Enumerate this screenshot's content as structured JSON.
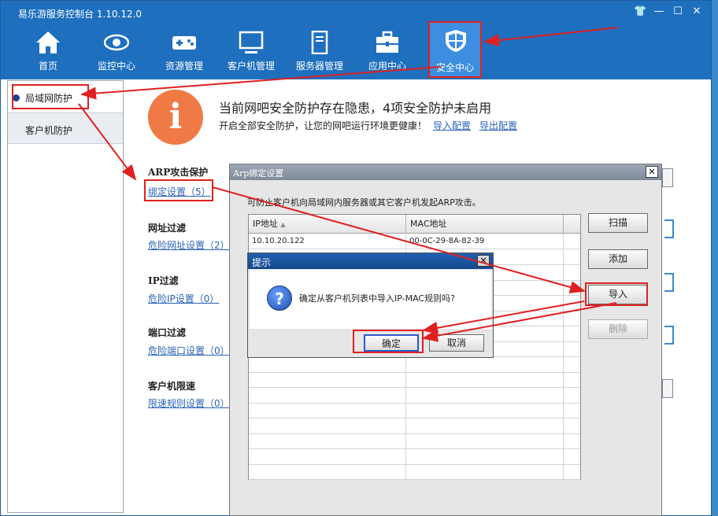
{
  "window": {
    "title": "易乐游服务控制台 1.10.12.0"
  },
  "toolbar": {
    "items": [
      {
        "label": "首页",
        "icon": "home-icon"
      },
      {
        "label": "监控中心",
        "icon": "eye-icon"
      },
      {
        "label": "资源管理",
        "icon": "gamepad-icon"
      },
      {
        "label": "客户机管理",
        "icon": "monitor-icon"
      },
      {
        "label": "服务器管理",
        "icon": "server-icon"
      },
      {
        "label": "应用中心",
        "icon": "toolbox-icon"
      },
      {
        "label": "安全中心",
        "icon": "shield-icon"
      }
    ]
  },
  "sidebar": {
    "items": [
      {
        "label": "局域网防护"
      },
      {
        "label": "客户机防护"
      }
    ]
  },
  "banner": {
    "title": "当前网吧安全防护存在隐患，4项安全防护未启用",
    "subtitle": "开启全部安全防护，让您的网吧运行环境更健康！",
    "import_config": "导入配置",
    "export_config": "导出配置"
  },
  "sections": [
    {
      "title": "ARP攻击保护",
      "link": "绑定设置（5）"
    },
    {
      "title": "网址过滤",
      "link": "危险网址设置（2）"
    },
    {
      "title": "IP过滤",
      "link": "危险IP设置（0）"
    },
    {
      "title": "端口过滤",
      "link": "危险端口设置（0）"
    },
    {
      "title": "客户机限速",
      "link": "限速规则设置（0）"
    }
  ],
  "arp_dialog": {
    "title": "Arp绑定设置",
    "description": "可防止客户机向局域网内服务器或其它客户机发起ARP攻击。",
    "columns": [
      "IP地址",
      "MAC地址"
    ],
    "rows": [
      {
        "ip": "10.10.20.122",
        "mac": "00-0C-29-8A-82-39"
      }
    ],
    "buttons": {
      "scan": "扫描",
      "add": "添加",
      "import": "导入",
      "delete": "删除"
    }
  },
  "confirm_dialog": {
    "title": "提示",
    "message": "确定从客户机列表中导入IP-MAC规则吗?",
    "ok": "确定",
    "cancel": "取消"
  },
  "colors": {
    "titlebar": "#1f6fbf",
    "accent_red": "#e02020",
    "link": "#2a63b8",
    "info_orange": "#f07a45"
  }
}
